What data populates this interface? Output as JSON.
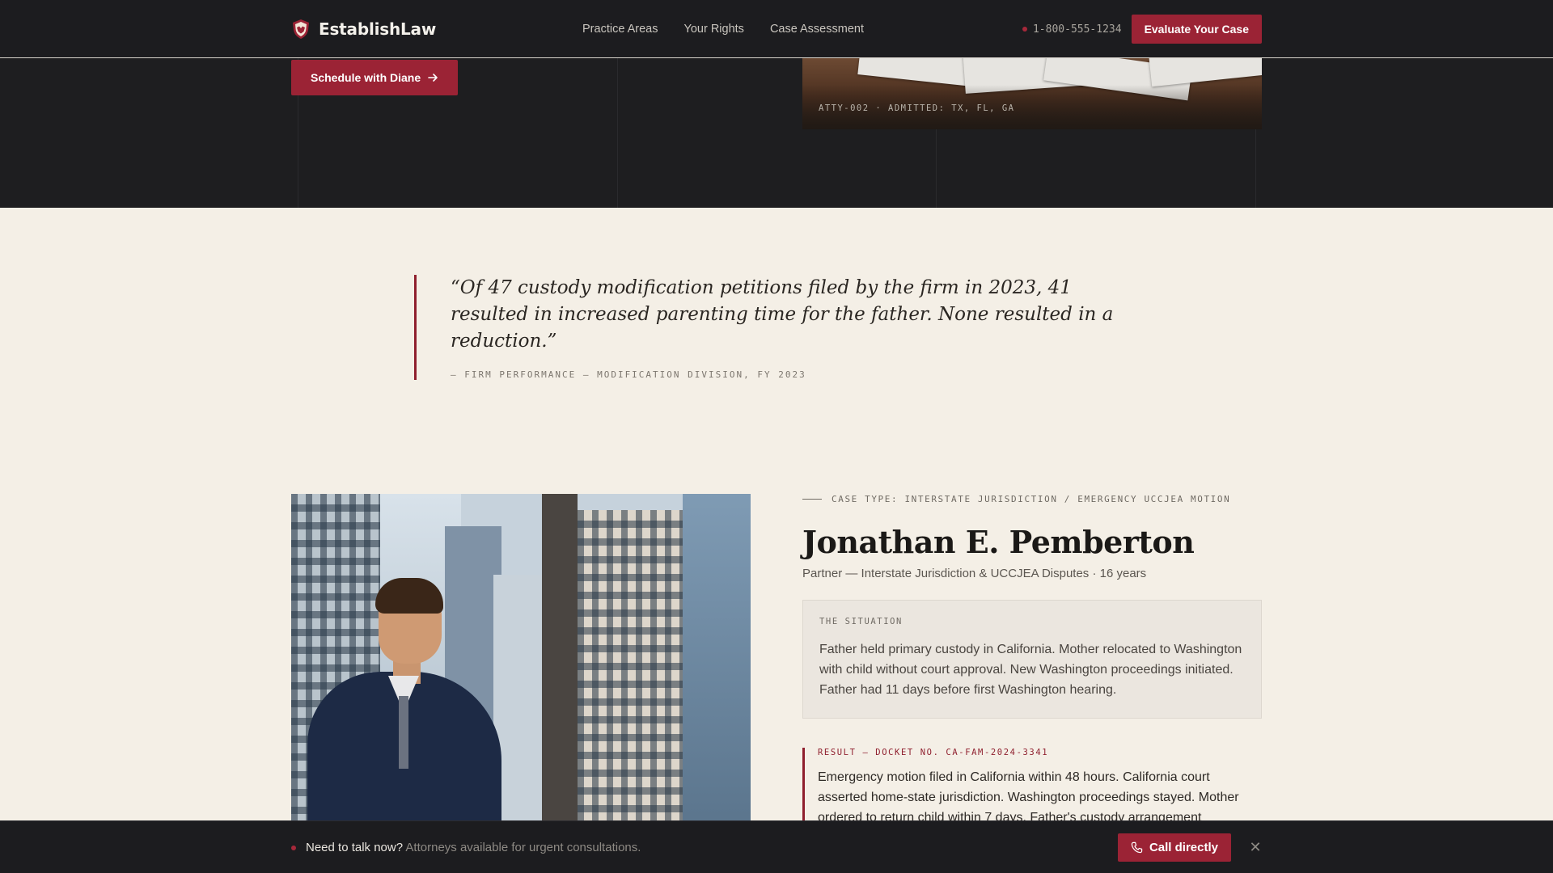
{
  "brand": {
    "name": "EstablishLaw",
    "logo_icon": "shield-logo-icon"
  },
  "nav": {
    "links": [
      "Practice Areas",
      "Your Rights",
      "Case Assessment"
    ],
    "phone": "1-800-555-1234",
    "cta": "Evaluate Your Case"
  },
  "hero": {
    "schedule_label": "Schedule with Diane",
    "photo_caption": "ATTY-002 · ADMITTED: TX, FL, GA"
  },
  "quote": {
    "text": "“Of 47 custody modification petitions filed by the firm in 2023, 41 resulted in increased parenting time for the father. None resulted in a reduction.”",
    "source": "— FIRM PERFORMANCE — MODIFICATION DIVISION, FY 2023"
  },
  "attorney": {
    "case_type": "CASE TYPE: INTERSTATE JURISDICTION / EMERGENCY UCCJEA MOTION",
    "name": "Jonathan E. Pemberton",
    "role": "Partner — Interstate Jurisdiction & UCCJEA Disputes · 16 years",
    "situation_label": "THE SITUATION",
    "situation_text": "Father held primary custody in California. Mother relocated to Washington with child without court approval. New Washington proceedings initiated. Father had 11 days before first Washington hearing.",
    "result_label": "RESULT — DOCKET NO. CA-FAM-2024-3341",
    "result_text": "Emergency motion filed in California within 48 hours. California court asserted home-state jurisdiction. Washington proceedings stayed. Mother ordered to return child within 7 days. Father's custody arrangement"
  },
  "bottom_bar": {
    "strong": "Need to talk now?",
    "sub": "Attorneys available for urgent consultations.",
    "call_label": "Call directly",
    "close_icon": "close-icon"
  },
  "colors": {
    "accent": "#9b2335",
    "dark": "#1c1c1f",
    "cream": "#f4efe6"
  }
}
